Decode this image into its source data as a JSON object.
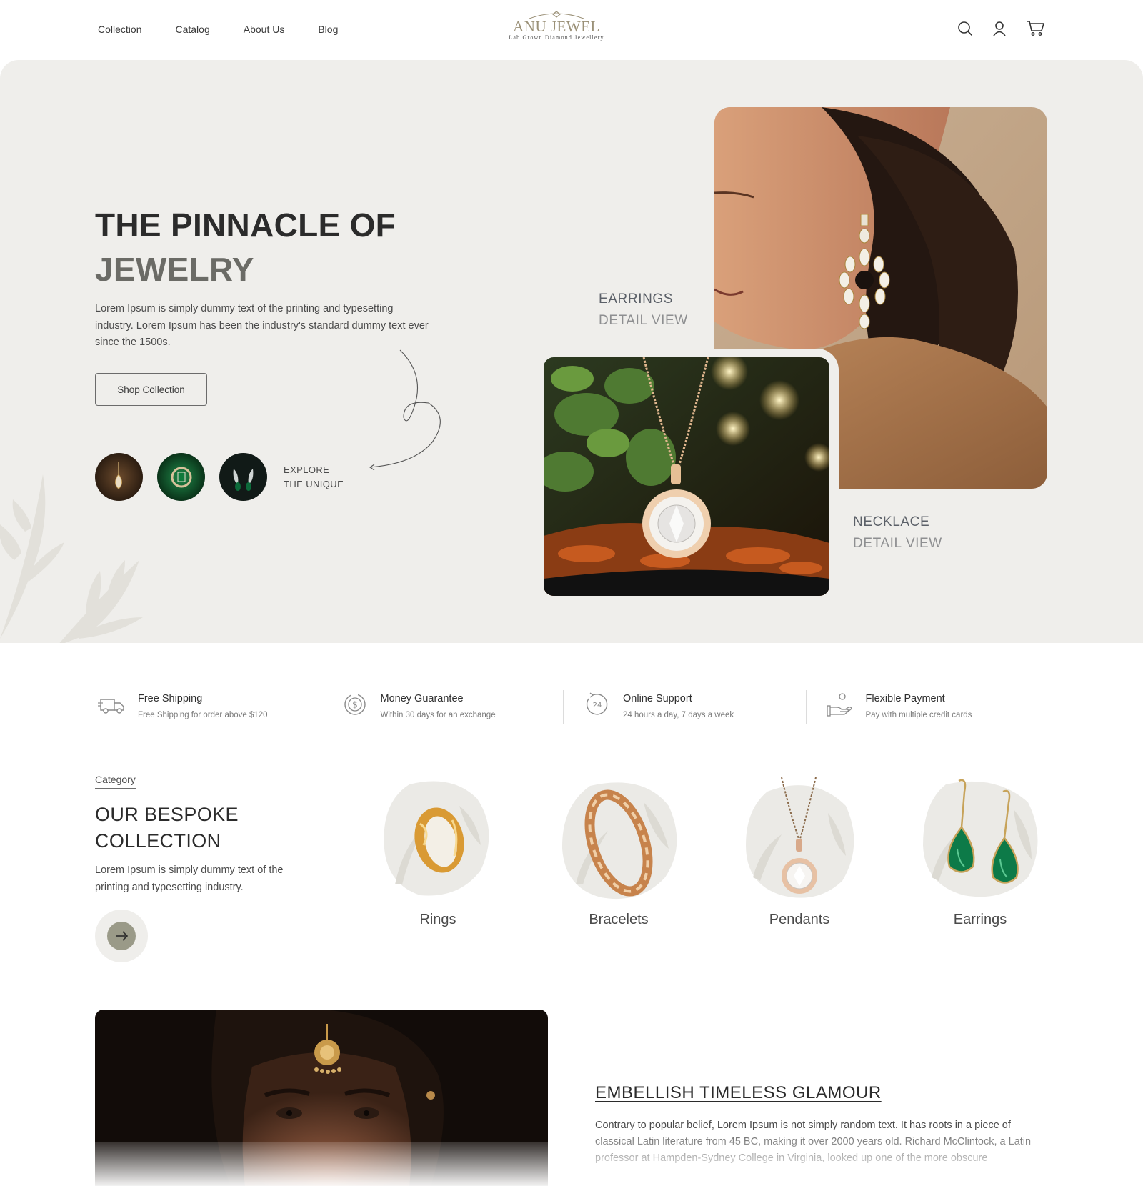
{
  "header": {
    "nav": [
      "Collection",
      "Catalog",
      "About Us",
      "Blog"
    ],
    "logo": {
      "brand": "ANU JEWEL",
      "tagline": "Lab Grown Diamond Jewellery"
    },
    "icons": [
      "search-icon",
      "user-icon",
      "cart-icon"
    ]
  },
  "hero": {
    "title_line1": "THE PINNACLE OF",
    "title_line2": "JEWELRY",
    "description": "Lorem Ipsum is simply dummy text of the printing and typesetting industry. Lorem Ipsum has been the industry's standard dummy text ever since the 1500s.",
    "cta": "Shop Collection",
    "explore_line1": "EXPLORE",
    "explore_line2": "THE UNIQUE",
    "earrings_label": "EARRINGS",
    "earrings_sub": "DETAIL VIEW",
    "necklace_label": "NECKLACE",
    "necklace_sub": "DETAIL VIEW"
  },
  "features": [
    {
      "icon": "truck-icon",
      "title": "Free Shipping",
      "subtitle": "Free Shipping for order above $120"
    },
    {
      "icon": "money-icon",
      "title": "Money Guarantee",
      "subtitle": "Within 30 days for an exchange"
    },
    {
      "icon": "support-24-icon",
      "title": "Online Support",
      "subtitle": "24 hours a day, 7 days a week"
    },
    {
      "icon": "payment-hand-icon",
      "title": "Flexible Payment",
      "subtitle": "Pay with multiple credit cards"
    }
  ],
  "category": {
    "kicker": "Category",
    "title_line1": "OUR BESPOKE",
    "title_line2": "COLLECTION",
    "description": "Lorem Ipsum is simply dummy text of the printing and typesetting industry.",
    "items": [
      "Rings",
      "Bracelets",
      "Pendants",
      "Earrings"
    ]
  },
  "feature_block": {
    "title": "EMBELLISH TIMELESS GLAMOUR",
    "text": "Contrary to popular belief, Lorem Ipsum is not simply random text. It has roots in a piece of classical Latin literature from 45 BC, making it over 2000 years old. Richard McClintock, a Latin professor at Hampden-Sydney College in Virginia, looked up one of the more obscure"
  },
  "colors": {
    "hero_bg": "#efeeeb",
    "accent_olive": "#9b9178",
    "text_dark": "#2b2b2b",
    "label_gray": "#5b6068"
  }
}
